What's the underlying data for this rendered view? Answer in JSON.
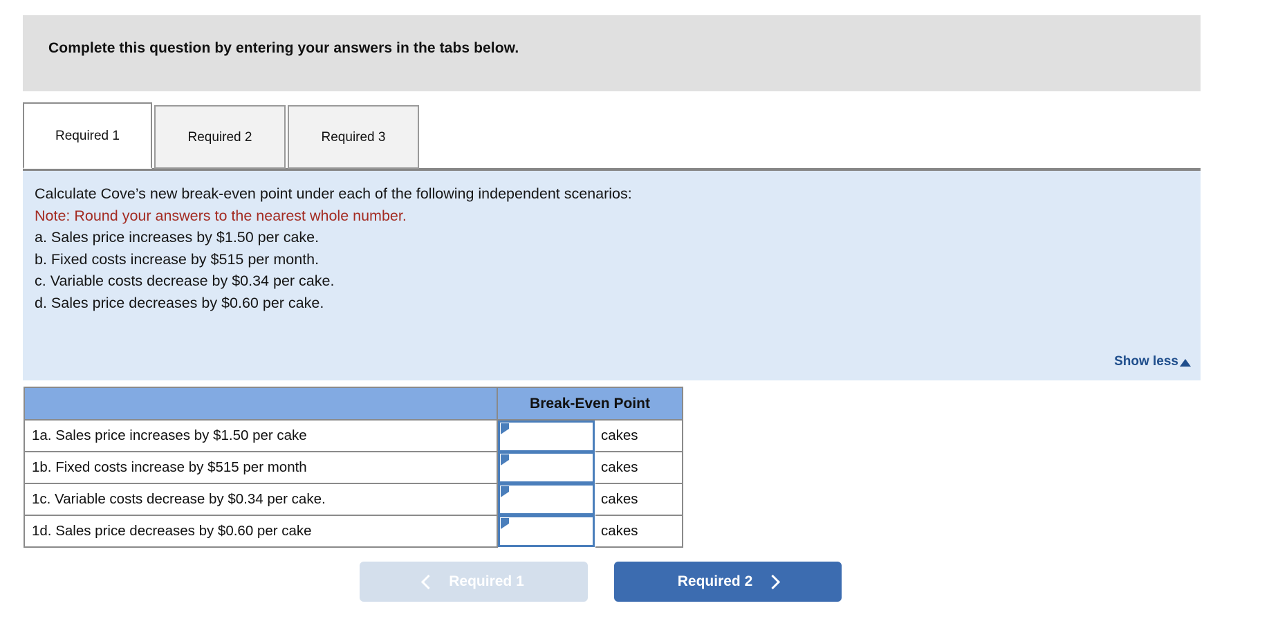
{
  "banner": {
    "title": "Complete this question by entering your answers in the tabs below."
  },
  "tabs": [
    {
      "label": "Required 1",
      "active": true
    },
    {
      "label": "Required 2",
      "active": false
    },
    {
      "label": "Required 3",
      "active": false
    }
  ],
  "question": {
    "prompt": "Calculate Cove’s new break-even point under each of the following independent scenarios:",
    "note": "Note: Round your answers to the nearest whole number.",
    "scenarios": [
      "a. Sales price increases by $1.50 per cake.",
      "b. Fixed costs increase by $515 per month.",
      "c. Variable costs decrease by $0.34 per cake.",
      "d. Sales price decreases by $0.60 per cake."
    ],
    "show_less_label": "Show less",
    "show_less_icon": "caret-up-icon",
    "note_color": "#a32b22",
    "panel_color": "#dde9f7"
  },
  "answer_table": {
    "headers": [
      "",
      "Break-Even Point"
    ],
    "header_color": "#82aae2",
    "rows": [
      {
        "label": "1a. Sales price increases by $1.50 per cake",
        "value": "",
        "unit": "cakes"
      },
      {
        "label": "1b. Fixed costs increase by $515 per month",
        "value": "",
        "unit": "cakes"
      },
      {
        "label": "1c. Variable costs decrease by $0.34 per cake.",
        "value": "",
        "unit": "cakes"
      },
      {
        "label": "1d. Sales price decreases by $0.60 per cake",
        "value": "",
        "unit": "cakes"
      }
    ]
  },
  "navigation": {
    "prev": {
      "label": "Required 1",
      "icon": "chevron-left-icon",
      "disabled": true,
      "color": "#d4dfec"
    },
    "next": {
      "label": "Required 2",
      "icon": "chevron-right-icon",
      "disabled": false,
      "color": "#3c6cb0"
    }
  }
}
